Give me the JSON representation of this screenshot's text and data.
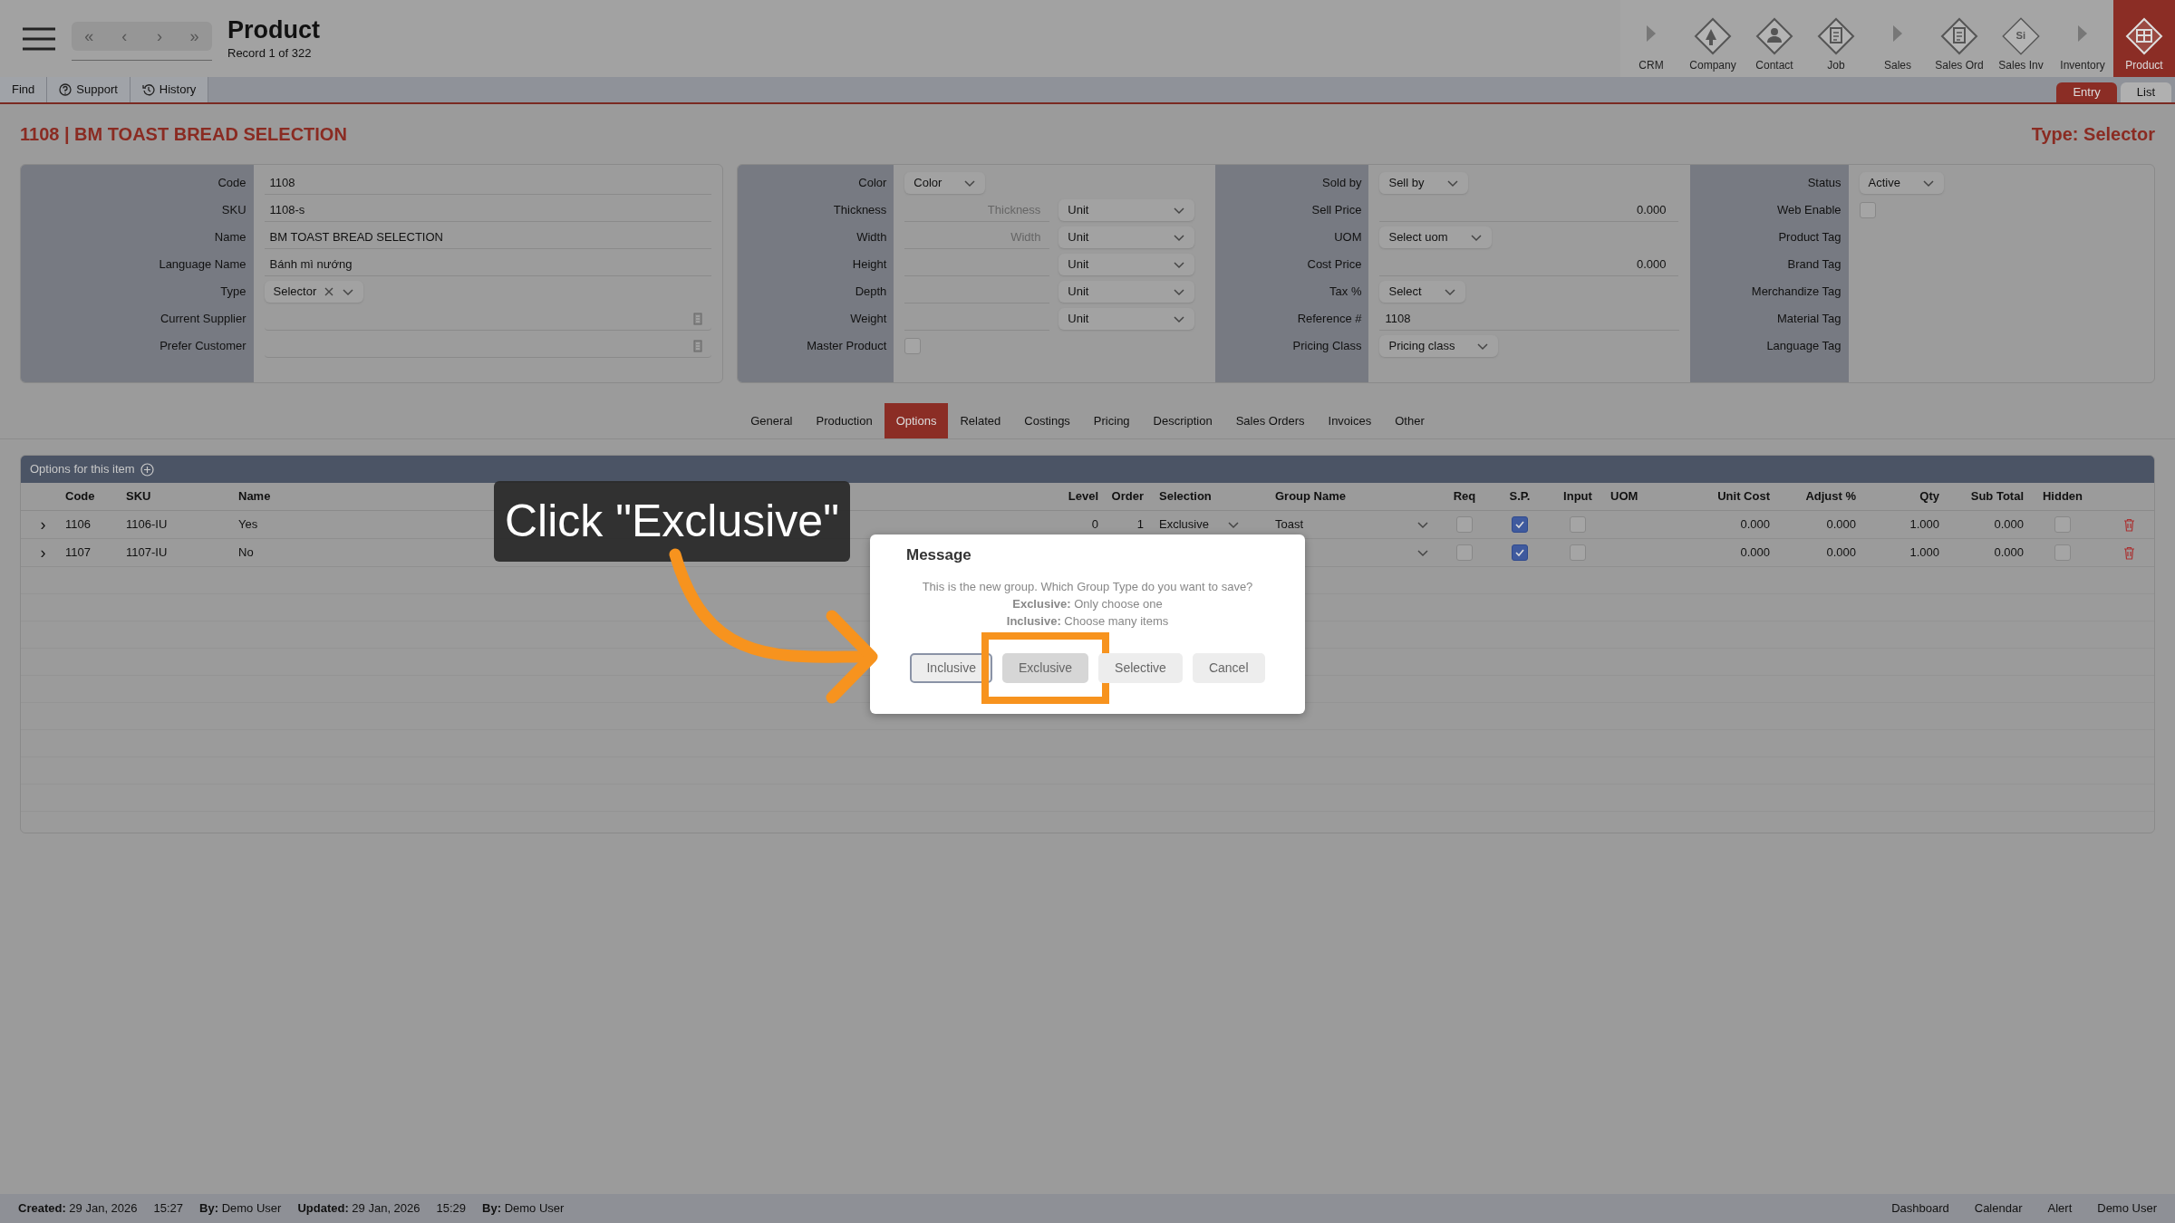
{
  "header": {
    "nav_buttons": [
      "«",
      "‹",
      "›",
      "»"
    ],
    "title": "Product",
    "subtitle": "Record 1 of 322",
    "modules": [
      {
        "label": "CRM",
        "kind": "group",
        "selected": false
      },
      {
        "label": "Company",
        "kind": "building",
        "selected": false
      },
      {
        "label": "Contact",
        "kind": "person",
        "selected": false
      },
      {
        "label": "Job",
        "kind": "document",
        "selected": false
      },
      {
        "label": "Sales",
        "kind": "group",
        "selected": false
      },
      {
        "label": "Sales Ord",
        "kind": "document",
        "selected": false
      },
      {
        "label": "Sales Inv",
        "kind": "letters",
        "icon_text": "Si",
        "selected": false
      },
      {
        "label": "Inventory",
        "kind": "group",
        "selected": false
      },
      {
        "label": "Product",
        "kind": "grid",
        "selected": true
      }
    ]
  },
  "toolbar": {
    "items": [
      {
        "label": "Find",
        "kind": "plain"
      },
      {
        "label": "Support",
        "kind": "help"
      },
      {
        "label": "History",
        "kind": "history"
      }
    ],
    "view_tabs": [
      {
        "label": "Entry",
        "selected": true
      },
      {
        "label": "List",
        "selected": false
      }
    ]
  },
  "record": {
    "heading": "1108 | BM TOAST BREAD SELECTION",
    "type_label": "Type: Selector"
  },
  "panels": [
    {
      "sections": [
        {
          "fields": [
            {
              "label": "Code",
              "kind": "text",
              "value": "1108"
            },
            {
              "label": "SKU",
              "kind": "text",
              "value": "1108-s"
            },
            {
              "label": "Name",
              "kind": "text",
              "value": "BM TOAST BREAD SELECTION"
            },
            {
              "label": "Language Name",
              "kind": "text",
              "value": "Bánh mì nướng"
            },
            {
              "label": "Type",
              "kind": "select_clear",
              "value": "Selector"
            },
            {
              "label": "Current Supplier",
              "kind": "lookup"
            },
            {
              "label": "Prefer Customer",
              "kind": "lookup"
            }
          ]
        }
      ]
    },
    {
      "sections": [
        {
          "fields": [
            {
              "label": "Color",
              "kind": "select",
              "value": "Color"
            },
            {
              "label": "Thickness",
              "kind": "measure",
              "placeholder": "Thickness",
              "unit": "Unit"
            },
            {
              "label": "Width",
              "kind": "measure",
              "placeholder": "Width",
              "unit": "Unit"
            },
            {
              "label": "Height",
              "kind": "measure",
              "unit": "Unit"
            },
            {
              "label": "Depth",
              "kind": "measure",
              "unit": "Unit"
            },
            {
              "label": "Weight",
              "kind": "measure",
              "unit": "Unit"
            },
            {
              "label": "Master Product",
              "kind": "checkbox",
              "checked": false
            }
          ]
        },
        {
          "fields": [
            {
              "label": "Sold by",
              "kind": "select",
              "value": "Sell by"
            },
            {
              "label": "Sell Price",
              "kind": "number",
              "value": "0.000"
            },
            {
              "label": "UOM",
              "kind": "select",
              "value": "Select uom"
            },
            {
              "label": "Cost Price",
              "kind": "number",
              "value": "0.000"
            },
            {
              "label": "Tax %",
              "kind": "select",
              "value": "Select"
            },
            {
              "label": "Reference #",
              "kind": "text",
              "value": "1108"
            },
            {
              "label": "Pricing Class",
              "kind": "select",
              "value": "Pricing class"
            }
          ]
        },
        {
          "fields": [
            {
              "label": "Status",
              "kind": "select",
              "value": "Active"
            },
            {
              "label": "Web Enable",
              "kind": "checkbox",
              "checked": false
            },
            {
              "label": "Product Tag",
              "kind": "tag"
            },
            {
              "label": "Brand Tag",
              "kind": "tag"
            },
            {
              "label": "Merchandize Tag",
              "kind": "tag"
            },
            {
              "label": "Material Tag",
              "kind": "tag"
            },
            {
              "label": "Language Tag",
              "kind": "tag"
            }
          ]
        }
      ]
    }
  ],
  "tabs": [
    {
      "label": "General",
      "selected": false
    },
    {
      "label": "Production",
      "selected": false
    },
    {
      "label": "Options",
      "selected": true
    },
    {
      "label": "Related",
      "selected": false
    },
    {
      "label": "Costings",
      "selected": false
    },
    {
      "label": "Pricing",
      "selected": false
    },
    {
      "label": "Description",
      "selected": false
    },
    {
      "label": "Sales Orders",
      "selected": false
    },
    {
      "label": "Invoices",
      "selected": false
    },
    {
      "label": "Other",
      "selected": false
    }
  ],
  "options": {
    "title": "Options for this item",
    "columns": [
      "Code",
      "SKU",
      "Name",
      "Level",
      "Order",
      "Selection",
      "Group Name",
      "Req",
      "S.P.",
      "Input",
      "UOM",
      "Unit Cost",
      "Adjust %",
      "Qty",
      "Sub Total",
      "Hidden"
    ],
    "rows": [
      {
        "expander": "›",
        "code": "1106",
        "sku": "1106-IU",
        "name": "Yes",
        "level": "0",
        "order": "1",
        "selection": "Exclusive",
        "group_name": "Toast",
        "req": false,
        "sp": true,
        "input": false,
        "unit_cost": "0.000",
        "adjust": "0.000",
        "qty": "1.000",
        "sub_total": "0.000",
        "hidden": false
      },
      {
        "expander": "›",
        "code": "1107",
        "sku": "1107-IU",
        "name": "No",
        "req": false,
        "sp": true,
        "input": false,
        "unit_cost": "0.000",
        "adjust": "0.000",
        "qty": "1.000",
        "sub_total": "0.000",
        "hidden": false
      }
    ]
  },
  "dialog": {
    "title": "Message",
    "lines": [
      "This is the new group. Which Group Type do you want to save?",
      "**Exclusive:** Only choose one",
      "**Inclusive:** Choose many items"
    ],
    "buttons": [
      {
        "label": "Inclusive",
        "focused": true,
        "highlighted": false
      },
      {
        "label": "Exclusive",
        "focused": false,
        "highlighted": true
      },
      {
        "label": "Selective",
        "focused": false,
        "highlighted": false
      },
      {
        "label": "Cancel",
        "focused": false,
        "highlighted": false
      }
    ]
  },
  "tutorial": {
    "callout": "Click \"Exclusive\""
  },
  "status_bar": {
    "left": [
      "**Created:** 29 Jan, 2026",
      "15:27",
      "**By:** Demo User",
      "**Updated:** 29 Jan, 2026",
      "15:29",
      "**By:** Demo User"
    ],
    "right": [
      "Dashboard",
      "Calendar",
      "Alert",
      "Demo User"
    ]
  }
}
